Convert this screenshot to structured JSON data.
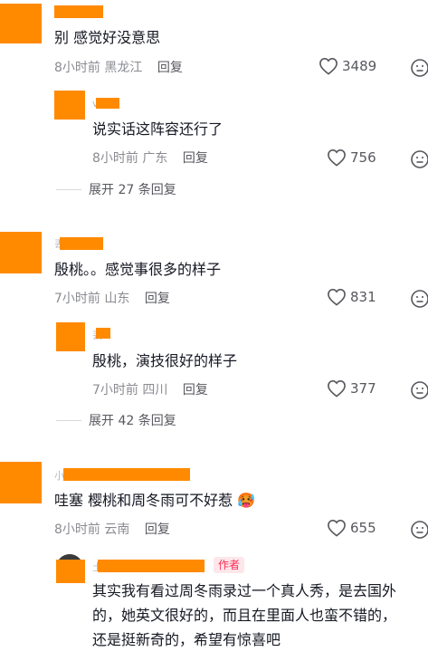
{
  "comments": [
    {
      "text": "别 感觉好没意思",
      "time": "8小时前",
      "location": "黑龙江",
      "reply": "回复",
      "likes": "3489",
      "replies": [
        {
          "name_partial": "v",
          "text": "说实话这阵容还行了",
          "time": "8小时前",
          "location": "广东",
          "reply": "回复",
          "likes": "756"
        }
      ],
      "expand": "展开 27 条回复"
    },
    {
      "name_partial": "丟",
      "text": "殷桃。。感觉事很多的样子",
      "time": "7小时前",
      "location": "山东",
      "reply": "回复",
      "likes": "831",
      "replies": [
        {
          "name_partial": "丟",
          "text": "殷桃，演技很好的样子",
          "time": "7小时前",
          "location": "四川",
          "reply": "回复",
          "likes": "377"
        }
      ],
      "expand": "展开 42 条回复"
    },
    {
      "name_partial": "小",
      "text": "哇塞 樱桃和周冬雨可不好惹",
      "emoji": "🥵",
      "time": "8小时前",
      "location": "云南",
      "reply": "回复",
      "likes": "655",
      "replies": [
        {
          "name_partial": "土",
          "badge": "作者",
          "text": "其实我有看过周冬雨录过一个真人秀，是去国外的，她英文很好的，而且在里面人也蛮不错的，还是挺新奇的，希望有惊喜吧"
        }
      ]
    }
  ],
  "icons": {
    "like": "heart-outline-icon",
    "more": "neutral-face-icon"
  },
  "colors": {
    "mask": "#ff8a00",
    "author_badge": "#fe2c55"
  }
}
